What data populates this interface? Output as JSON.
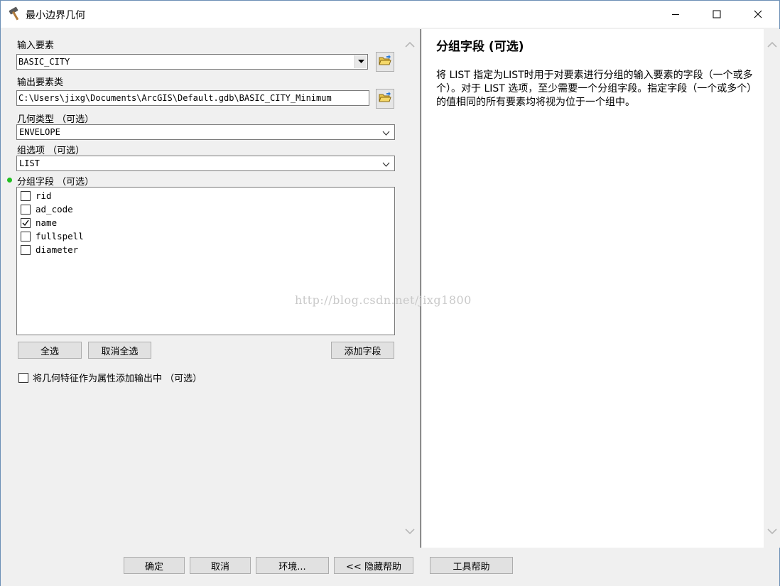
{
  "window": {
    "title": "最小边界几何",
    "icon": "hammer-icon"
  },
  "form": {
    "input_features": {
      "label": "输入要素",
      "value": "BASIC_CITY"
    },
    "output_feature_class": {
      "label": "输出要素类",
      "value": "C:\\Users\\jixg\\Documents\\ArcGIS\\Default.gdb\\BASIC_CITY_Minimum"
    },
    "geometry_type": {
      "label": "几何类型 （可选）",
      "value": "ENVELOPE"
    },
    "group_option": {
      "label": "组选项 （可选）",
      "value": "LIST"
    },
    "group_fields": {
      "label": "分组字段 （可选）",
      "items": [
        {
          "name": "rid",
          "checked": false
        },
        {
          "name": "ad_code",
          "checked": false
        },
        {
          "name": "name",
          "checked": true
        },
        {
          "name": "fullspell",
          "checked": false
        },
        {
          "name": "diameter",
          "checked": false
        }
      ],
      "select_all": "全选",
      "unselect_all": "取消全选",
      "add_field": "添加字段"
    },
    "add_geometry_characteristics": {
      "label": "将几何特征作为属性添加输出中 （可选）",
      "checked": false
    }
  },
  "help": {
    "title": "分组字段 (可选)",
    "body": "将 LIST 指定为LIST时用于对要素进行分组的输入要素的字段（一个或多个）。对于 LIST 选项，至少需要一个分组字段。指定字段（一个或多个）的值相同的所有要素均将视为位于一个组中。"
  },
  "buttons": {
    "ok": "确定",
    "cancel": "取消",
    "environments": "环境...",
    "hide_help": "<< 隐藏帮助",
    "tool_help": "工具帮助"
  },
  "watermark": "http://blog.csdn.net/jixg1800"
}
